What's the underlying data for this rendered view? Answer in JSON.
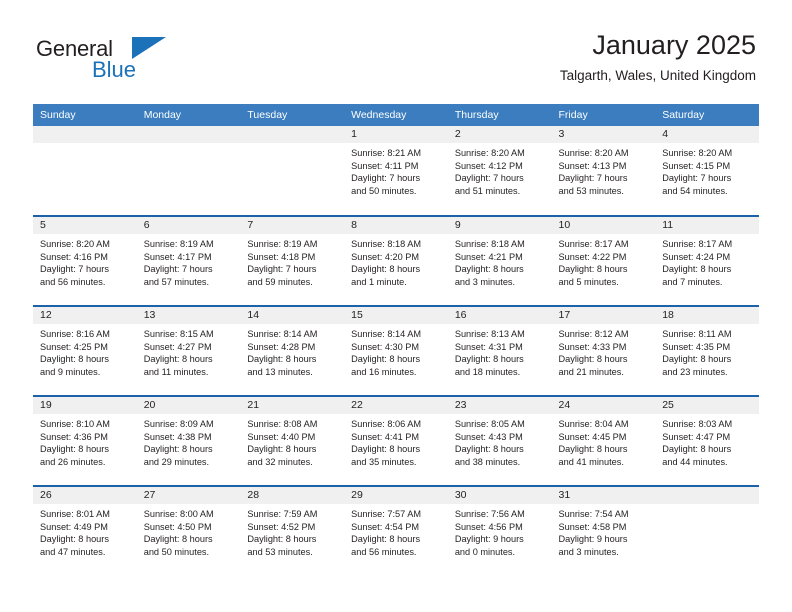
{
  "brand": {
    "name_part1": "General",
    "name_part2": "Blue",
    "logo_icon": "triangle-flag-icon",
    "accent_color": "#1c72b8"
  },
  "header": {
    "month_title": "January 2025",
    "location": "Talgarth, Wales, United Kingdom"
  },
  "colors": {
    "header_row_bg": "#3b7dbf",
    "row_divider": "#1c62a8",
    "daynum_band_bg": "#f0f0f0",
    "text": "#231f20"
  },
  "weekday_headers": [
    "Sunday",
    "Monday",
    "Tuesday",
    "Wednesday",
    "Thursday",
    "Friday",
    "Saturday"
  ],
  "weeks": [
    [
      {
        "day": "",
        "empty": true,
        "sunrise": "",
        "sunset": "",
        "daylight1": "",
        "daylight2": ""
      },
      {
        "day": "",
        "empty": true,
        "sunrise": "",
        "sunset": "",
        "daylight1": "",
        "daylight2": ""
      },
      {
        "day": "",
        "empty": true,
        "sunrise": "",
        "sunset": "",
        "daylight1": "",
        "daylight2": ""
      },
      {
        "day": "1",
        "sunrise": "Sunrise: 8:21 AM",
        "sunset": "Sunset: 4:11 PM",
        "daylight1": "Daylight: 7 hours",
        "daylight2": "and 50 minutes."
      },
      {
        "day": "2",
        "sunrise": "Sunrise: 8:20 AM",
        "sunset": "Sunset: 4:12 PM",
        "daylight1": "Daylight: 7 hours",
        "daylight2": "and 51 minutes."
      },
      {
        "day": "3",
        "sunrise": "Sunrise: 8:20 AM",
        "sunset": "Sunset: 4:13 PM",
        "daylight1": "Daylight: 7 hours",
        "daylight2": "and 53 minutes."
      },
      {
        "day": "4",
        "sunrise": "Sunrise: 8:20 AM",
        "sunset": "Sunset: 4:15 PM",
        "daylight1": "Daylight: 7 hours",
        "daylight2": "and 54 minutes."
      }
    ],
    [
      {
        "day": "5",
        "sunrise": "Sunrise: 8:20 AM",
        "sunset": "Sunset: 4:16 PM",
        "daylight1": "Daylight: 7 hours",
        "daylight2": "and 56 minutes."
      },
      {
        "day": "6",
        "sunrise": "Sunrise: 8:19 AM",
        "sunset": "Sunset: 4:17 PM",
        "daylight1": "Daylight: 7 hours",
        "daylight2": "and 57 minutes."
      },
      {
        "day": "7",
        "sunrise": "Sunrise: 8:19 AM",
        "sunset": "Sunset: 4:18 PM",
        "daylight1": "Daylight: 7 hours",
        "daylight2": "and 59 minutes."
      },
      {
        "day": "8",
        "sunrise": "Sunrise: 8:18 AM",
        "sunset": "Sunset: 4:20 PM",
        "daylight1": "Daylight: 8 hours",
        "daylight2": "and 1 minute."
      },
      {
        "day": "9",
        "sunrise": "Sunrise: 8:18 AM",
        "sunset": "Sunset: 4:21 PM",
        "daylight1": "Daylight: 8 hours",
        "daylight2": "and 3 minutes."
      },
      {
        "day": "10",
        "sunrise": "Sunrise: 8:17 AM",
        "sunset": "Sunset: 4:22 PM",
        "daylight1": "Daylight: 8 hours",
        "daylight2": "and 5 minutes."
      },
      {
        "day": "11",
        "sunrise": "Sunrise: 8:17 AM",
        "sunset": "Sunset: 4:24 PM",
        "daylight1": "Daylight: 8 hours",
        "daylight2": "and 7 minutes."
      }
    ],
    [
      {
        "day": "12",
        "sunrise": "Sunrise: 8:16 AM",
        "sunset": "Sunset: 4:25 PM",
        "daylight1": "Daylight: 8 hours",
        "daylight2": "and 9 minutes."
      },
      {
        "day": "13",
        "sunrise": "Sunrise: 8:15 AM",
        "sunset": "Sunset: 4:27 PM",
        "daylight1": "Daylight: 8 hours",
        "daylight2": "and 11 minutes."
      },
      {
        "day": "14",
        "sunrise": "Sunrise: 8:14 AM",
        "sunset": "Sunset: 4:28 PM",
        "daylight1": "Daylight: 8 hours",
        "daylight2": "and 13 minutes."
      },
      {
        "day": "15",
        "sunrise": "Sunrise: 8:14 AM",
        "sunset": "Sunset: 4:30 PM",
        "daylight1": "Daylight: 8 hours",
        "daylight2": "and 16 minutes."
      },
      {
        "day": "16",
        "sunrise": "Sunrise: 8:13 AM",
        "sunset": "Sunset: 4:31 PM",
        "daylight1": "Daylight: 8 hours",
        "daylight2": "and 18 minutes."
      },
      {
        "day": "17",
        "sunrise": "Sunrise: 8:12 AM",
        "sunset": "Sunset: 4:33 PM",
        "daylight1": "Daylight: 8 hours",
        "daylight2": "and 21 minutes."
      },
      {
        "day": "18",
        "sunrise": "Sunrise: 8:11 AM",
        "sunset": "Sunset: 4:35 PM",
        "daylight1": "Daylight: 8 hours",
        "daylight2": "and 23 minutes."
      }
    ],
    [
      {
        "day": "19",
        "sunrise": "Sunrise: 8:10 AM",
        "sunset": "Sunset: 4:36 PM",
        "daylight1": "Daylight: 8 hours",
        "daylight2": "and 26 minutes."
      },
      {
        "day": "20",
        "sunrise": "Sunrise: 8:09 AM",
        "sunset": "Sunset: 4:38 PM",
        "daylight1": "Daylight: 8 hours",
        "daylight2": "and 29 minutes."
      },
      {
        "day": "21",
        "sunrise": "Sunrise: 8:08 AM",
        "sunset": "Sunset: 4:40 PM",
        "daylight1": "Daylight: 8 hours",
        "daylight2": "and 32 minutes."
      },
      {
        "day": "22",
        "sunrise": "Sunrise: 8:06 AM",
        "sunset": "Sunset: 4:41 PM",
        "daylight1": "Daylight: 8 hours",
        "daylight2": "and 35 minutes."
      },
      {
        "day": "23",
        "sunrise": "Sunrise: 8:05 AM",
        "sunset": "Sunset: 4:43 PM",
        "daylight1": "Daylight: 8 hours",
        "daylight2": "and 38 minutes."
      },
      {
        "day": "24",
        "sunrise": "Sunrise: 8:04 AM",
        "sunset": "Sunset: 4:45 PM",
        "daylight1": "Daylight: 8 hours",
        "daylight2": "and 41 minutes."
      },
      {
        "day": "25",
        "sunrise": "Sunrise: 8:03 AM",
        "sunset": "Sunset: 4:47 PM",
        "daylight1": "Daylight: 8 hours",
        "daylight2": "and 44 minutes."
      }
    ],
    [
      {
        "day": "26",
        "sunrise": "Sunrise: 8:01 AM",
        "sunset": "Sunset: 4:49 PM",
        "daylight1": "Daylight: 8 hours",
        "daylight2": "and 47 minutes."
      },
      {
        "day": "27",
        "sunrise": "Sunrise: 8:00 AM",
        "sunset": "Sunset: 4:50 PM",
        "daylight1": "Daylight: 8 hours",
        "daylight2": "and 50 minutes."
      },
      {
        "day": "28",
        "sunrise": "Sunrise: 7:59 AM",
        "sunset": "Sunset: 4:52 PM",
        "daylight1": "Daylight: 8 hours",
        "daylight2": "and 53 minutes."
      },
      {
        "day": "29",
        "sunrise": "Sunrise: 7:57 AM",
        "sunset": "Sunset: 4:54 PM",
        "daylight1": "Daylight: 8 hours",
        "daylight2": "and 56 minutes."
      },
      {
        "day": "30",
        "sunrise": "Sunrise: 7:56 AM",
        "sunset": "Sunset: 4:56 PM",
        "daylight1": "Daylight: 9 hours",
        "daylight2": "and 0 minutes."
      },
      {
        "day": "31",
        "sunrise": "Sunrise: 7:54 AM",
        "sunset": "Sunset: 4:58 PM",
        "daylight1": "Daylight: 9 hours",
        "daylight2": "and 3 minutes."
      },
      {
        "day": "",
        "empty": true,
        "sunrise": "",
        "sunset": "",
        "daylight1": "",
        "daylight2": ""
      }
    ]
  ]
}
